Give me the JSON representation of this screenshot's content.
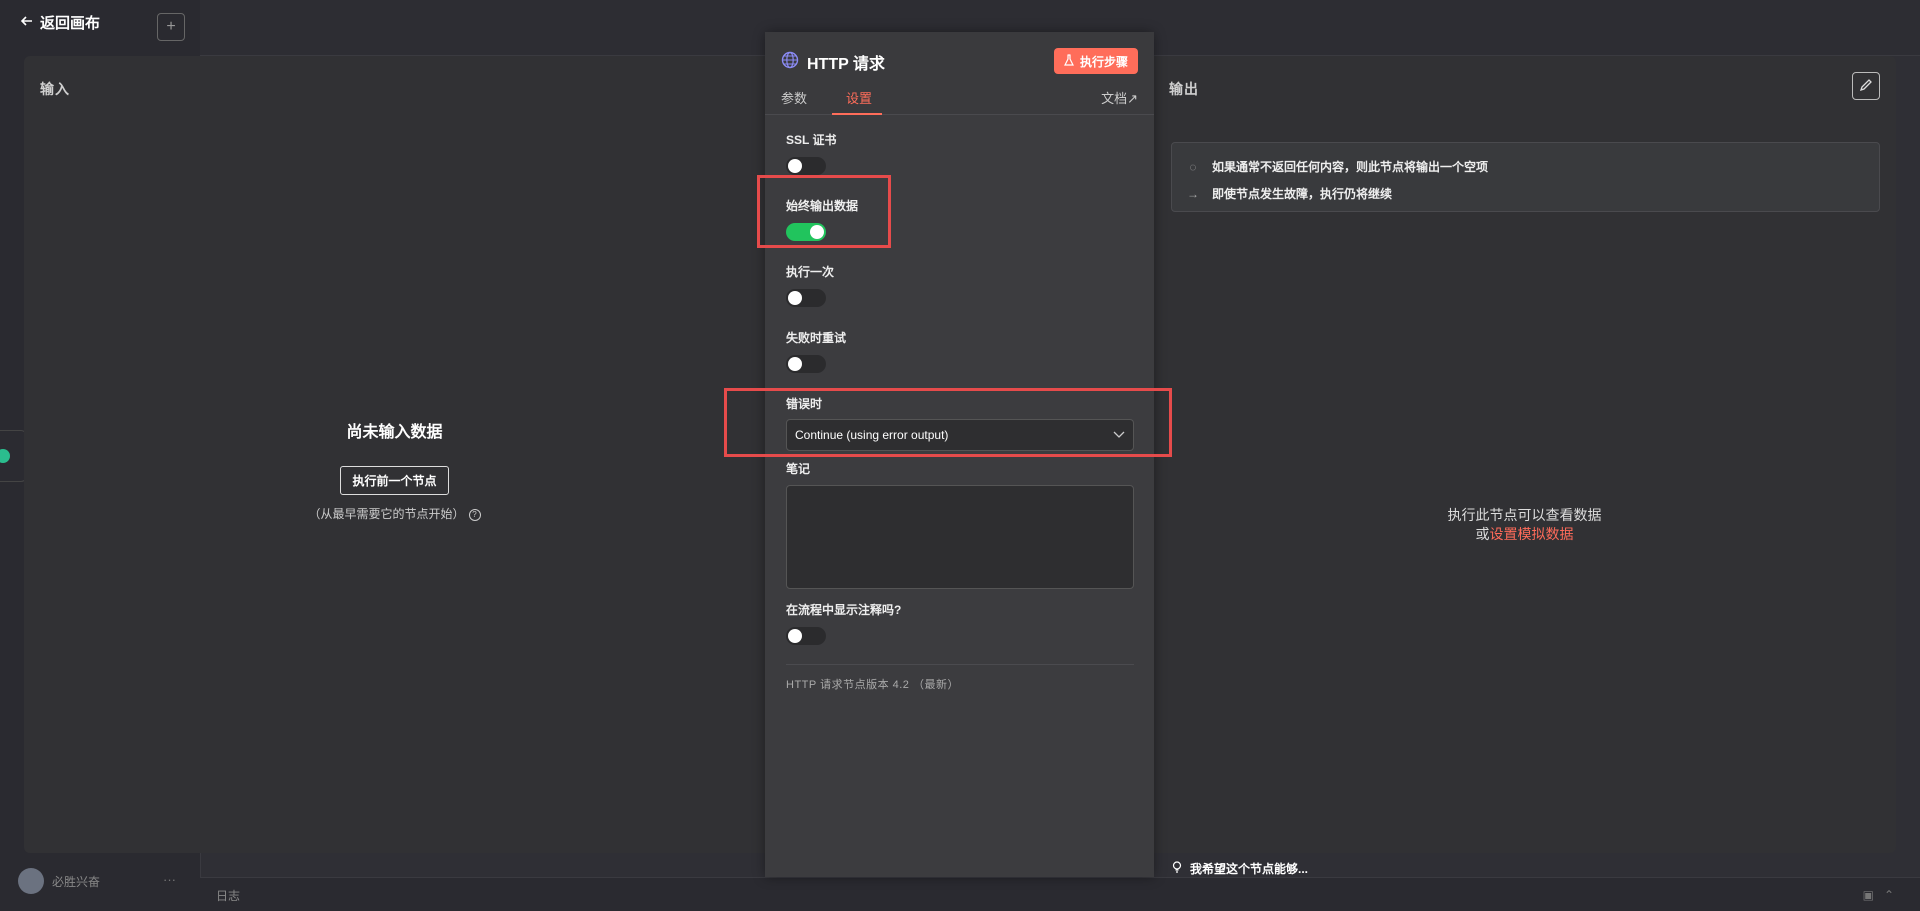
{
  "app": {
    "back_label": "返回画布",
    "user_name": "必胜兴奋",
    "logs_label": "日志",
    "wish_text": "我希望这个节点能够..."
  },
  "input_panel": {
    "title": "输入",
    "empty_title": "尚未输入数据",
    "exec_prev_button": "执行前一个节点",
    "hint": "（从最早需要它的节点开始）"
  },
  "output_panel": {
    "title": "输出",
    "notice": [
      {
        "icon": "dashed-circle-icon",
        "text": "如果通常不返回任何内容，则此节点将输出一个空项"
      },
      {
        "icon": "arrow-right-icon",
        "text": "即使节点发生故障，执行仍将继续"
      }
    ],
    "empty_line1": "执行此节点可以查看数据",
    "empty_or": "或",
    "empty_link": "设置模拟数据"
  },
  "dialog": {
    "title": "HTTP 请求",
    "run_button": "执行步骤",
    "tabs": [
      "参数",
      "设置"
    ],
    "active_tab": "设置",
    "docs_label": "文档",
    "settings": {
      "ssl_label": "SSL 证书",
      "ssl_on": false,
      "always_output_label": "始终输出数据",
      "always_output_on": true,
      "execute_once_label": "执行一次",
      "execute_once_on": false,
      "retry_label": "失败时重试",
      "retry_on": false,
      "on_error_label": "错误时",
      "on_error_value": "Continue (using error output)",
      "notes_label": "笔记",
      "notes_value": "",
      "show_notes_label": "在流程中显示注释吗?",
      "show_notes_on": false
    },
    "version_text": "HTTP 请求节点版本 4.2 （最新）"
  },
  "colors": {
    "accent": "#ff6d5a",
    "toggle_on": "#21c45d",
    "highlight": "#e64b4b"
  }
}
